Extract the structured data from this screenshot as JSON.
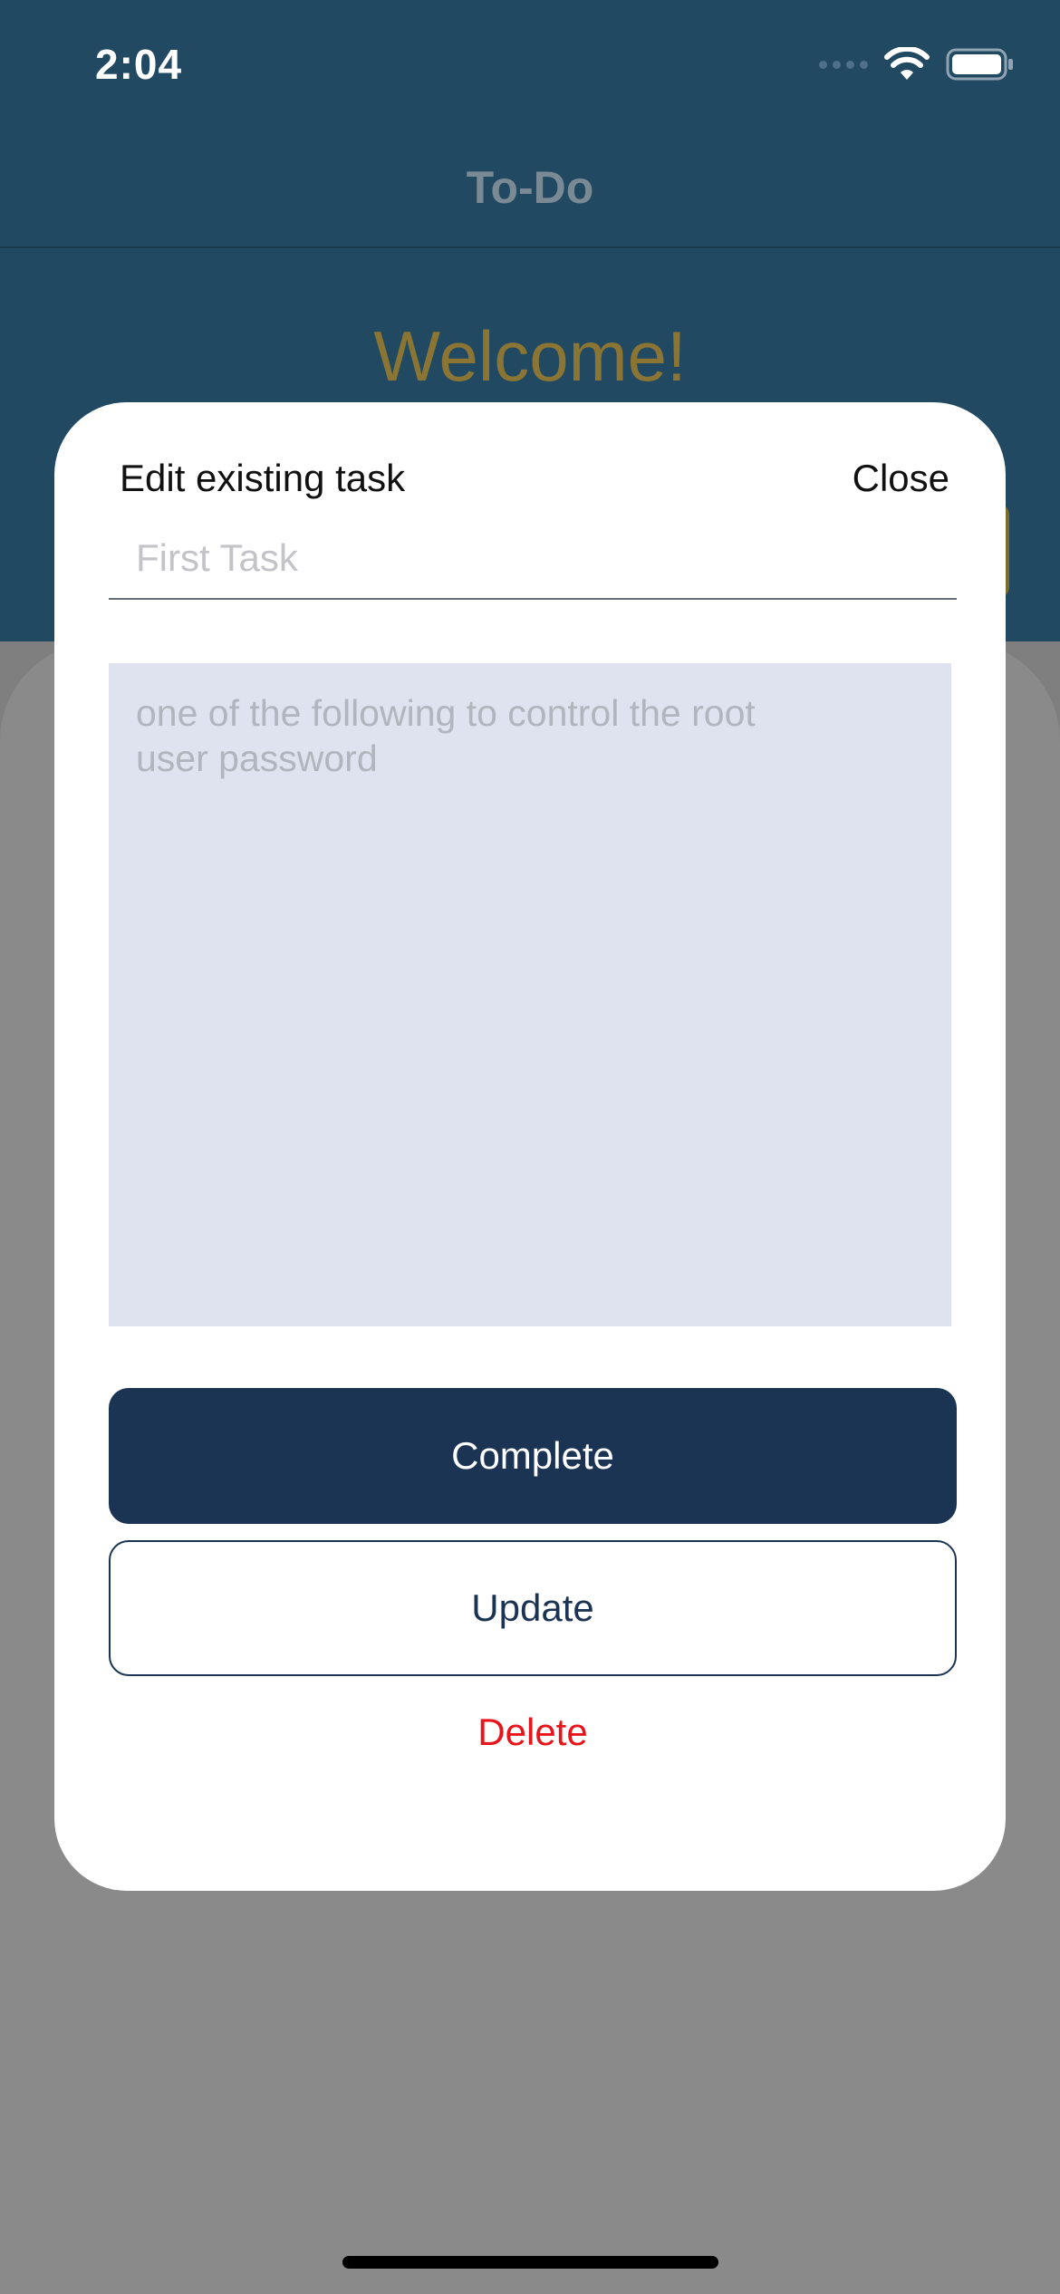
{
  "status_bar": {
    "time": "2:04",
    "icons": [
      "signal-dots-icon",
      "wifi-icon",
      "battery-icon"
    ]
  },
  "nav": {
    "title": "To-Do"
  },
  "background": {
    "welcome_text": "Welcome!"
  },
  "modal": {
    "title": "Edit existing task",
    "close_label": "Close",
    "task_title": {
      "value": "",
      "placeholder": "First Task"
    },
    "task_description": {
      "value": "",
      "placeholder": "one of the following to control the root user password"
    },
    "complete_label": "Complete",
    "update_label": "Update",
    "delete_label": "Delete"
  },
  "colors": {
    "header_bg": "#214962",
    "overlay": "#7f7f7f",
    "primary": "#1c3453",
    "description_bg": "#dee3ef",
    "delete": "#e8141b",
    "welcome": "#8a7534"
  }
}
